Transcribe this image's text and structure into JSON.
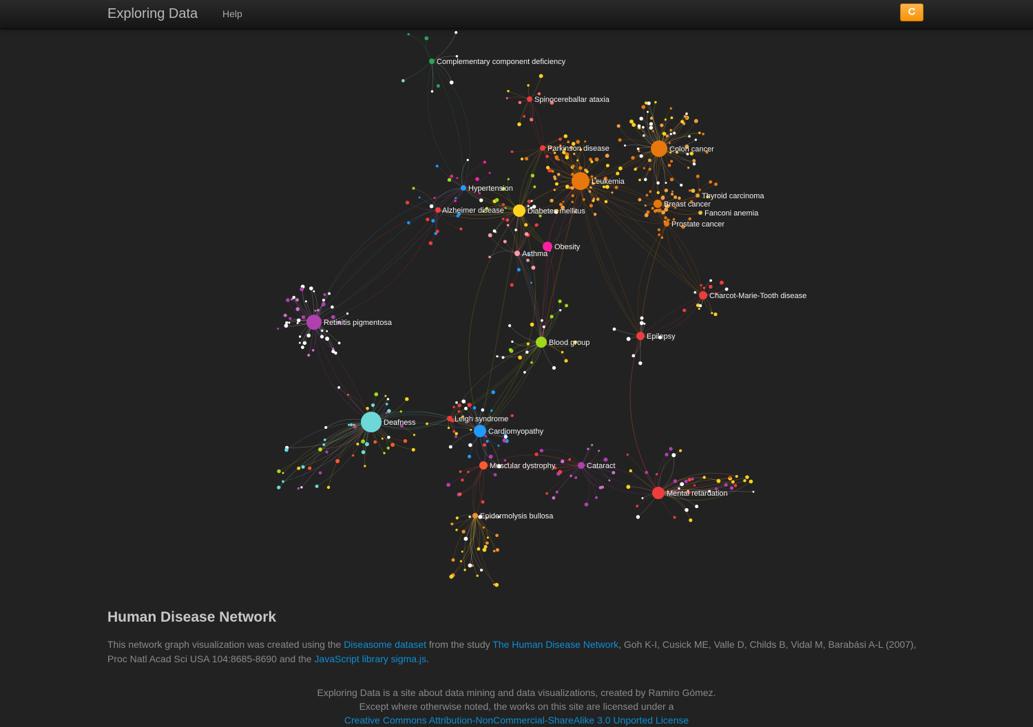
{
  "navbar": {
    "brand": "Exploring Data",
    "help_label": "Help",
    "refresh_icon": "refresh-icon",
    "accent_color": "#f89406"
  },
  "graph": {
    "library": "sigma.js",
    "background": "#222222",
    "hubs": [
      {
        "id": "complementary",
        "label": "Complementary component deficiency",
        "color": "#2aa55a",
        "size": 4
      },
      {
        "id": "spino",
        "label": "Spinocereballar ataxia",
        "color": "#f03c3c",
        "size": 4
      },
      {
        "id": "parkinson",
        "label": "Parkinson disease",
        "color": "#f03c3c",
        "size": 4
      },
      {
        "id": "colon",
        "label": "Colon cancer",
        "color": "#e8770e",
        "size": 12
      },
      {
        "id": "leukemia",
        "label": "Leukemia",
        "color": "#e8770e",
        "size": 13
      },
      {
        "id": "hypertension",
        "label": "Hypertension",
        "color": "#1f9bff",
        "size": 4
      },
      {
        "id": "thyroid",
        "label": "Thyroid carcinoma",
        "color": "#e8a030",
        "size": 3
      },
      {
        "id": "breast",
        "label": "Breast cancer",
        "color": "#e8770e",
        "size": 6
      },
      {
        "id": "fanconi",
        "label": "Fanconi anemia",
        "color": "#e8c040",
        "size": 3
      },
      {
        "id": "alzheimer",
        "label": "Alzheimer disease",
        "color": "#f03c3c",
        "size": 4
      },
      {
        "id": "diabetes",
        "label": "Diabetes mellitus",
        "color": "#ffd21f",
        "size": 9
      },
      {
        "id": "prostate",
        "label": "Prostate cancer",
        "color": "#e8770e",
        "size": 4
      },
      {
        "id": "obesity",
        "label": "Obesity",
        "color": "#ff1fa0",
        "size": 7
      },
      {
        "id": "asthma",
        "label": "Asthma",
        "color": "#ff9aa8",
        "size": 4
      },
      {
        "id": "cmt",
        "label": "Charcot-Marie-Tooth disease",
        "color": "#f03c3c",
        "size": 6
      },
      {
        "id": "retinitis",
        "label": "Retinitis pigmentosa",
        "color": "#b040b0",
        "size": 11
      },
      {
        "id": "blood",
        "label": "Blood group",
        "color": "#9ed81a",
        "size": 8
      },
      {
        "id": "epilepsy",
        "label": "Epilepsy",
        "color": "#f03c3c",
        "size": 6
      },
      {
        "id": "deafness",
        "label": "Deafness",
        "color": "#6ed8d8",
        "size": 15
      },
      {
        "id": "leigh",
        "label": "Leigh syndrome",
        "color": "#f03c3c",
        "size": 4
      },
      {
        "id": "cardio",
        "label": "Cardiomyopathy",
        "color": "#1f9bff",
        "size": 9
      },
      {
        "id": "muscular",
        "label": "Muscular dystrophy",
        "color": "#ff5a30",
        "size": 6
      },
      {
        "id": "cataract",
        "label": "Cataract",
        "color": "#b040b0",
        "size": 5
      },
      {
        "id": "mental",
        "label": "Mental retardation",
        "color": "#f03c3c",
        "size": 9
      },
      {
        "id": "epidermolysis",
        "label": "Epidermolysis bullosa",
        "color": "#f0902a",
        "size": 4
      }
    ]
  },
  "main": {
    "title": "Human Disease Network",
    "desc_1": "This network graph visualization was created using the ",
    "link_dataset": "Diseasome dataset",
    "desc_2": " from the study ",
    "link_study": "The Human Disease Network",
    "desc_3": ", Goh K-I, Cusick ME, Valle D, Childs B, Vidal M, Barabási A-L (2007), Proc Natl Acad Sci USA 104:8685-8690 and the ",
    "link_sigma": "JavaScript library sigma.js",
    "desc_4": "."
  },
  "footer": {
    "line1": "Exploring Data is a site about data mining and data visualizations, created by Ramiro Gómez.",
    "line2": "Except where otherwise noted, the works on this site are licensed under a",
    "license_link": "Creative Commons Attribution-NonCommercial-ShareAlike 3.0 Unported License"
  }
}
